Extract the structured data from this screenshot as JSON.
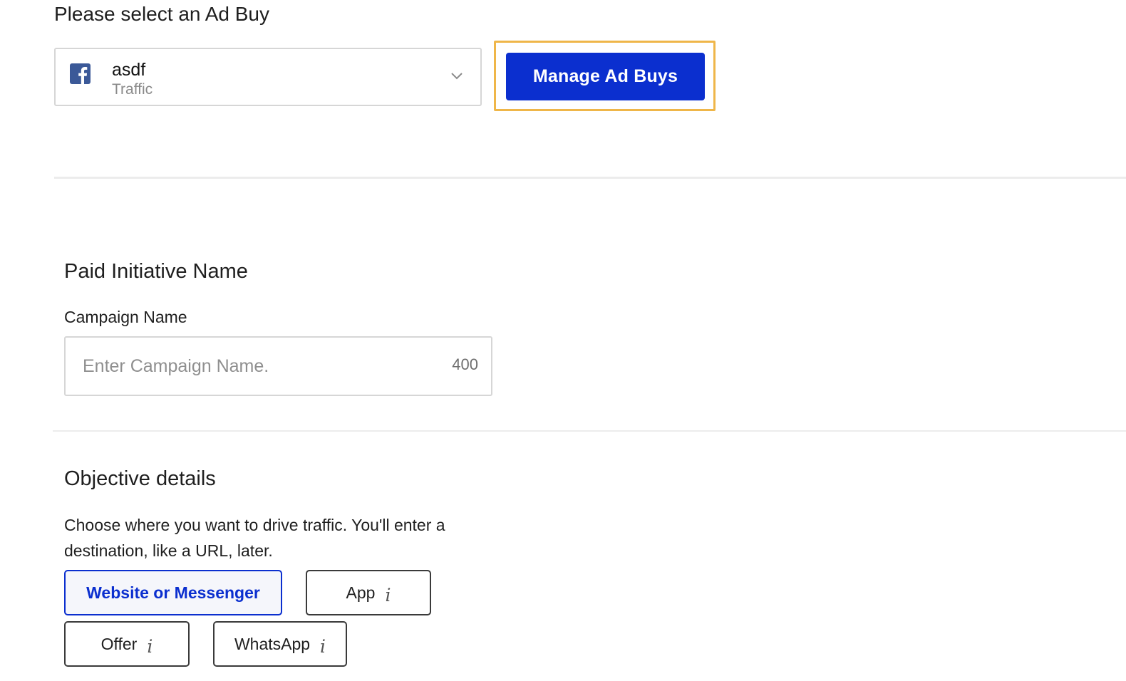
{
  "header": {
    "title": "Please select an Ad Buy"
  },
  "ad_buy": {
    "name": "asdf",
    "type": "Traffic",
    "platform_icon": "facebook-icon",
    "dropdown_icon": "chevron-down-icon"
  },
  "manage_button": {
    "label": "Manage Ad Buys"
  },
  "paid_initiative": {
    "heading": "Paid Initiative Name",
    "campaign_label": "Campaign Name",
    "campaign_placeholder": "Enter Campaign Name.",
    "campaign_value": "",
    "char_remaining": "400"
  },
  "objective": {
    "heading": "Objective details",
    "helper": "Choose where you want to drive traffic. You'll enter a destination, like a URL, later.",
    "options": [
      {
        "label": "Website or Messenger",
        "selected": true,
        "info": ""
      },
      {
        "label": "App",
        "selected": false,
        "info": "i"
      },
      {
        "label": "Offer",
        "selected": false,
        "info": "i"
      },
      {
        "label": "WhatsApp",
        "selected": false,
        "info": "i"
      }
    ]
  },
  "colors": {
    "primary": "#0b2fcf",
    "highlight": "#efb649",
    "facebook": "#3b5998"
  }
}
